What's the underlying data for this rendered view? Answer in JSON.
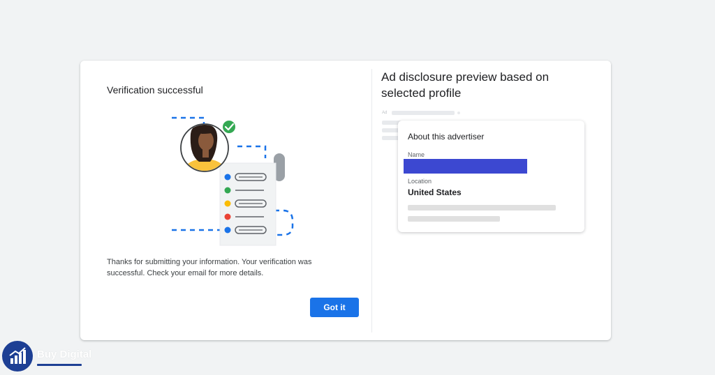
{
  "verification": {
    "title": "Verification successful",
    "message": "Thanks for submitting your information. Your verification was successful. Check your email for more details.",
    "got_it_label": "Got it"
  },
  "preview": {
    "title": "Ad disclosure preview based on selected profile",
    "ad_label": "Ad",
    "advertiser_card": {
      "title": "About this advertiser",
      "name_label": "Name",
      "location_label": "Location",
      "location_value": "United States"
    }
  },
  "watermark": {
    "text": "Buy Digital"
  },
  "colors": {
    "primary_button": "#1a73e8",
    "redaction": "#3c48d1",
    "checkmark": "#34a853",
    "dot_blue": "#1a73e8",
    "dot_green": "#34a853",
    "dot_yellow": "#fbbc04",
    "dot_red": "#ea4335"
  },
  "icons": {
    "success": "checkmark-circle-icon",
    "avatar": "avatar-illustration",
    "logo": "bar-chart-growth-icon"
  }
}
